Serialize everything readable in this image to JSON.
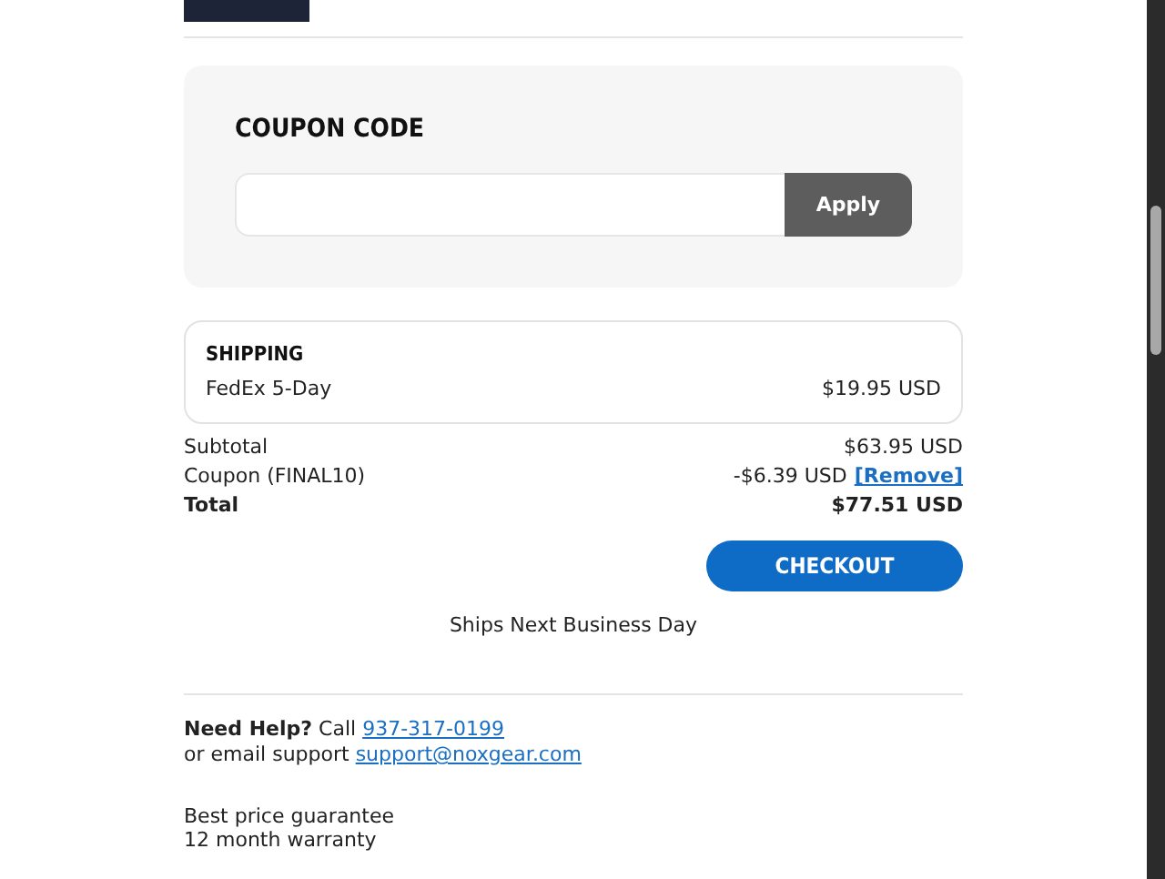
{
  "coupon": {
    "title": "COUPON CODE",
    "button": "Apply"
  },
  "shipping": {
    "title": "SHIPPING",
    "method": "FedEx 5-Day",
    "price": "$19.95 USD"
  },
  "summary": [
    {
      "kind": "plain",
      "label": "Subtotal",
      "value": "$63.95 USD"
    },
    {
      "kind": "coupon",
      "label": "Coupon (FINAL10)",
      "value": "-$6.39 USD",
      "link": "[Remove]"
    },
    {
      "kind": "total",
      "label": "Total",
      "value": "$77.51 USD"
    }
  ],
  "checkout": "CHECKOUT",
  "ships_note": "Ships Next Business Day",
  "help": {
    "lead": "Need Help?",
    "call": "Call",
    "phone": "937-317-0199",
    "email_text": "or email support",
    "email": "support@noxgear.com"
  },
  "perks": [
    "Best price guarantee",
    "12 month warranty"
  ]
}
